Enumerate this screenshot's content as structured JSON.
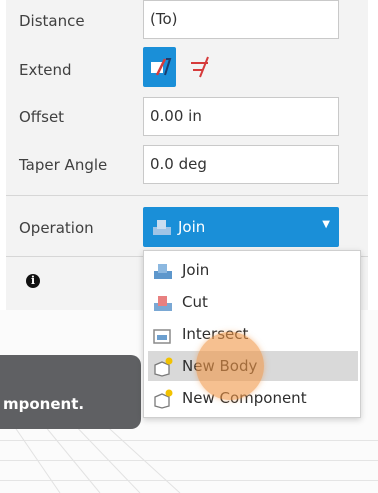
{
  "fields": {
    "distance": {
      "label": "Distance",
      "value": "(To)"
    },
    "extend": {
      "label": "Extend",
      "icon_selected": "extend-to-object-icon",
      "icon_alt": "extend-min-solution-icon"
    },
    "offset": {
      "label": "Offset",
      "value": "0.00 in"
    },
    "taper": {
      "label": "Taper Angle",
      "value": "0.0 deg"
    }
  },
  "operation": {
    "label": "Operation",
    "selected": "Join",
    "options": [
      {
        "label": "Join",
        "icon": "join-icon"
      },
      {
        "label": "Cut",
        "icon": "cut-icon"
      },
      {
        "label": "Intersect",
        "icon": "intersect-icon"
      },
      {
        "label": "New Body",
        "icon": "new-body-icon",
        "highlighted": true
      },
      {
        "label": "New Component",
        "icon": "new-component-icon"
      }
    ]
  },
  "info_symbol": "i",
  "tooltip_text": "mponent.",
  "colors": {
    "accent": "#1a8fd8",
    "panel": "#f3f3f3",
    "tooltip": "#5f6063",
    "cursor": "#f0a060"
  }
}
